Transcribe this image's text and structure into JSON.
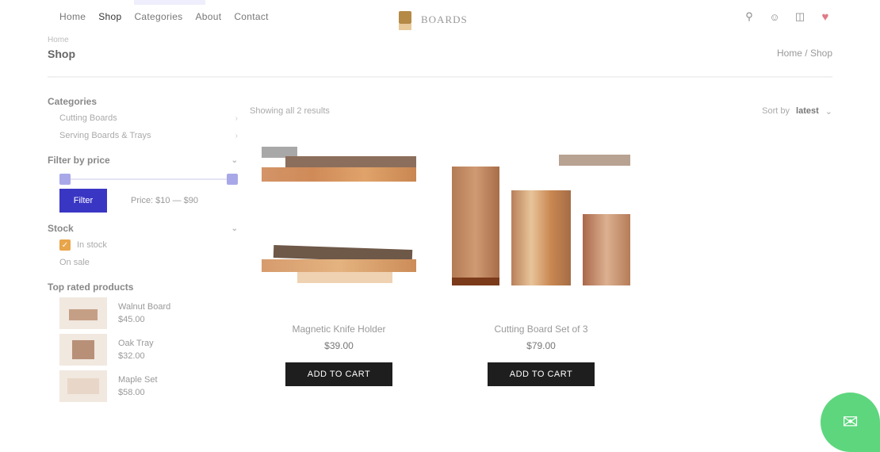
{
  "nav": {
    "links": [
      "Home",
      "Shop",
      "Categories",
      "About",
      "Contact"
    ],
    "logo_text": "BOARDS",
    "icons": [
      "search-icon",
      "user-icon",
      "cart-icon",
      "heart-icon"
    ]
  },
  "page": {
    "title": "Shop",
    "crumb_small": "Home",
    "breadcrumb": "Home / Shop"
  },
  "sidebar": {
    "categories": {
      "title": "Categories",
      "items": [
        "Cutting Boards",
        "Serving Boards & Trays"
      ]
    },
    "price": {
      "title": "Filter by price",
      "button": "Filter",
      "range": "Price: $10 — $90"
    },
    "stock": {
      "title": "Stock",
      "items": [
        "In stock",
        "On sale"
      ]
    },
    "top_rated": {
      "title": "Top rated products",
      "items": [
        {
          "name": "Walnut Board",
          "price": "$45.00"
        },
        {
          "name": "Oak Tray",
          "price": "$32.00"
        },
        {
          "name": "Maple Set",
          "price": "$58.00"
        }
      ]
    }
  },
  "main": {
    "results": "Showing all 2 results",
    "sort_label": "Sort by",
    "sort_value": "latest",
    "products": [
      {
        "title": "Magnetic Knife Holder",
        "price": "$39.00",
        "button": "ADD TO CART"
      },
      {
        "title": "Cutting Board Set of 3",
        "price": "$79.00",
        "button": "ADD TO CART"
      }
    ]
  },
  "colors": {
    "accent": "#3a36c4",
    "button_dark": "#1e1e1e",
    "chat": "#5ed67e",
    "stock_check": "#e8a54a"
  }
}
